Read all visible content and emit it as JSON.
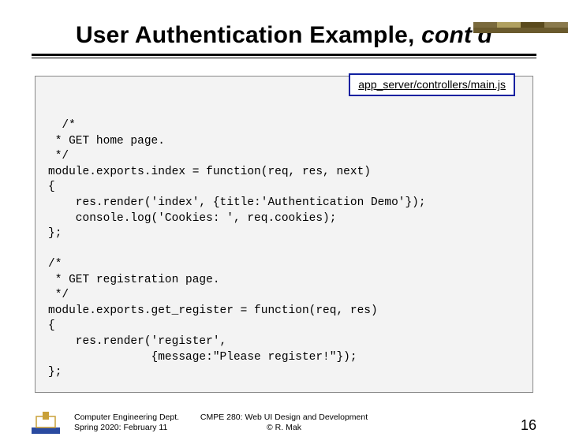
{
  "slide": {
    "title_main": "User Authentication Example, ",
    "title_em": "cont'd",
    "file_badge": "app_server/controllers/main.js",
    "code": "/*\n * GET home page.\n */\nmodule.exports.index = function(req, res, next)\n{\n    res.render('index', {title:'Authentication Demo'});\n    console.log('Cookies: ', req.cookies);\n};\n\n/*\n * GET registration page.\n */\nmodule.exports.get_register = function(req, res)\n{\n    res.render('register',\n               {message:\"Please register!\"});\n};",
    "footer_left_1": "Computer Engineering Dept.",
    "footer_left_2": "Spring 2020: February 11",
    "footer_center_1": "CMPE 280: Web UI Design and Development",
    "footer_center_2": "© R. Mak",
    "page_number": "16"
  }
}
